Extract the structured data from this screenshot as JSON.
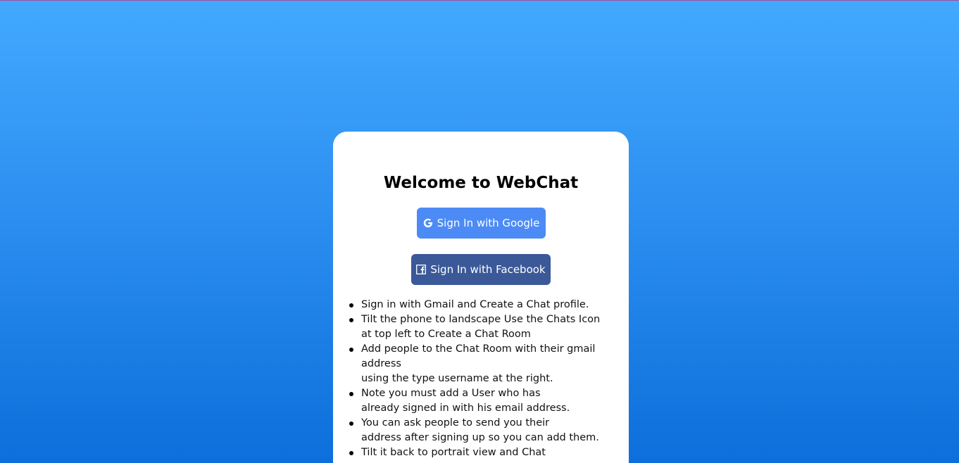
{
  "welcome": {
    "title": "Welcome to WebChat"
  },
  "buttons": {
    "google": {
      "label": "Sign In with Google",
      "icon": "google-icon",
      "color": "#4c8bf5"
    },
    "facebook": {
      "label": "Sign In with Facebook",
      "icon": "facebook-icon",
      "color": "#3b5998"
    }
  },
  "instructions": [
    {
      "lines": [
        "Sign in with Gmail and Create a Chat profile."
      ]
    },
    {
      "lines": [
        "Tilt the phone to landscape Use the Chats Icon",
        "at top left to Create a Chat Room"
      ]
    },
    {
      "lines": [
        "Add people to the Chat Room with their gmail",
        "address",
        "using the type username at the right."
      ]
    },
    {
      "lines": [
        "Note you must add a User who has",
        "already signed in with his email address."
      ]
    },
    {
      "lines": [
        "You can ask people to send you their",
        "address after signing up so you can add them."
      ]
    },
    {
      "lines": [
        "Tilt it back to portrait view and Chat"
      ]
    }
  ]
}
